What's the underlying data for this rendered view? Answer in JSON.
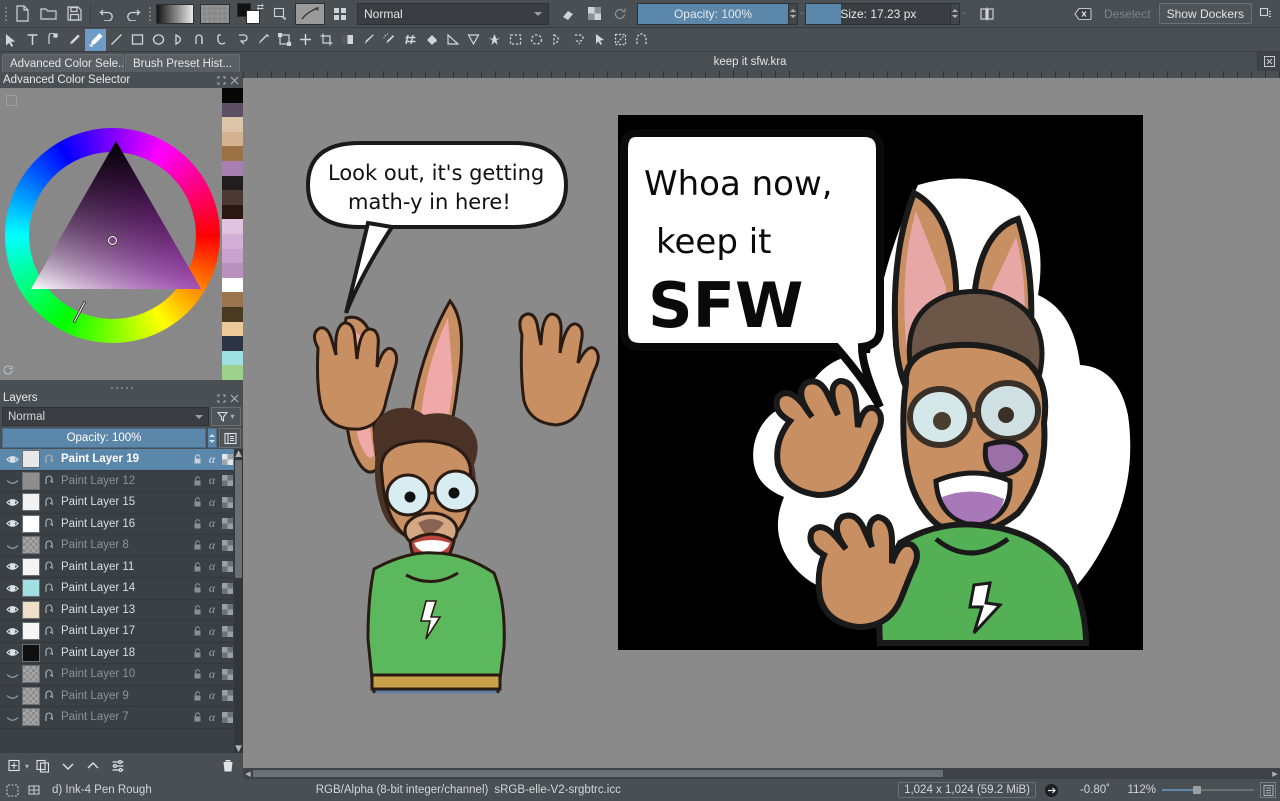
{
  "app": {
    "name": "Krita"
  },
  "toolbar": {
    "items": [
      {
        "name": "new-document-button",
        "icon": "new-file-icon",
        "label": "New"
      },
      {
        "name": "open-document-button",
        "icon": "folder-open-icon",
        "label": "Open"
      },
      {
        "name": "save-document-button",
        "icon": "floppy-save-icon",
        "label": "Save"
      },
      {
        "name": "undo-button",
        "icon": "undo-arrow-icon",
        "label": "Undo"
      },
      {
        "name": "redo-button",
        "icon": "redo-arrow-icon",
        "label": "Redo"
      }
    ],
    "gradient_label": "Gradients",
    "pattern_label": "Patterns",
    "fgbg_label": "Foreground/Background colors",
    "fill_layer_label": "Edit fill layer",
    "brush_editor_label": "Edit brush settings",
    "preset_chooser_label": "Choose brush preset",
    "blending_mode": "Normal",
    "eraser_label": "Eraser mode",
    "alpha_label": "Preserve alpha",
    "reset_label": "Reset",
    "opacity_label": "Opacity: 100%",
    "opacity_value": 100,
    "size_label": "Size: 17.23 px",
    "size_value": "17.23 px",
    "mirror_label": "Mirror",
    "deselect_label": "Deselect",
    "show_dockers_label": "Show Dockers"
  },
  "tools": {
    "active": "freehand-brush",
    "items": [
      {
        "name": "tool-select-shapes",
        "icon": "cursor-arrow-icon"
      },
      {
        "name": "tool-text",
        "icon": "text-icon"
      },
      {
        "name": "tool-edit-shapes",
        "icon": "node-edit-icon"
      },
      {
        "name": "tool-calligraphy",
        "icon": "calligraphy-pen-icon"
      },
      {
        "name": "tool-freehand-brush",
        "icon": "paintbrush-icon"
      },
      {
        "name": "tool-line",
        "icon": "line-icon"
      },
      {
        "name": "tool-rectangle",
        "icon": "rectangle-icon"
      },
      {
        "name": "tool-ellipse",
        "icon": "ellipse-icon"
      },
      {
        "name": "tool-polygon",
        "icon": "polygon-icon"
      },
      {
        "name": "tool-polyline",
        "icon": "polyline-icon"
      },
      {
        "name": "tool-bezier-curve",
        "icon": "bezier-curve-icon"
      },
      {
        "name": "tool-freehand-path",
        "icon": "freehand-path-icon"
      },
      {
        "name": "tool-dynamic-brush",
        "icon": "dynamic-brush-icon"
      },
      {
        "name": "tool-multibrush",
        "icon": "multibrush-icon"
      },
      {
        "name": "tool-transform",
        "icon": "transform-icon"
      },
      {
        "name": "tool-move",
        "icon": "move-cross-icon"
      },
      {
        "name": "tool-crop",
        "icon": "crop-icon"
      },
      {
        "name": "tool-gradient",
        "icon": "gradient-icon"
      },
      {
        "name": "tool-color-sampler",
        "icon": "eyedropper-icon"
      },
      {
        "name": "tool-colorize-mask",
        "icon": "colorize-mask-icon"
      },
      {
        "name": "tool-smart-patch",
        "icon": "smart-patch-icon"
      },
      {
        "name": "tool-fill",
        "icon": "fill-bucket-icon"
      },
      {
        "name": "tool-measure",
        "icon": "measure-icon"
      },
      {
        "name": "tool-assistant",
        "icon": "assistant-icon"
      },
      {
        "name": "tool-reference-images",
        "icon": "reference-image-icon"
      },
      {
        "name": "tool-rectangular-select",
        "icon": "rect-select-icon"
      },
      {
        "name": "tool-elliptical-select",
        "icon": "ellipse-select-icon"
      },
      {
        "name": "tool-polygonal-select",
        "icon": "polygon-select-icon"
      },
      {
        "name": "tool-freehand-select",
        "icon": "freehand-select-icon"
      },
      {
        "name": "tool-contiguous-select",
        "icon": "contiguous-select-icon"
      },
      {
        "name": "tool-similar-select",
        "icon": "similar-select-icon"
      },
      {
        "name": "tool-magnetic-select",
        "icon": "magnetic-select-icon"
      }
    ]
  },
  "left_dock": {
    "tabs": [
      {
        "name": "tab-advanced-color-selector",
        "label": "Advanced Color Sele...",
        "active": true
      },
      {
        "name": "tab-brush-preset-history",
        "label": "Brush Preset Hist...",
        "active": false
      }
    ],
    "color_selector": {
      "title": "Advanced Color Selector",
      "float_label": "Float docker",
      "close_label": "Close docker",
      "reset_label": "Reset",
      "palette_swatches": [
        "#070707",
        "#5c4f63",
        "#dcc5ab",
        "#d4b191",
        "#9a7245",
        "#a77fb0",
        "#211c1e",
        "#4a3a33",
        "#2a1713",
        "#dfc3e0",
        "#d3afd8",
        "#c9a3ce",
        "#b891bd",
        "#ffffff",
        "#9a7550",
        "#4a3a22",
        "#edc999",
        "#2b3344",
        "#9fe0e0",
        "#9dd18c"
      ]
    },
    "layers": {
      "title": "Layers",
      "float_label": "Float docker",
      "close_label": "Close docker",
      "blending_mode": "Normal",
      "filter_label": "Filter layers",
      "opacity_label": "Opacity:  100%",
      "opacity_value": 100,
      "properties_label": "Layer properties",
      "rows": [
        {
          "label": "Paint Layer 19",
          "visible": true,
          "selected": true,
          "thumb": "sketch"
        },
        {
          "label": "Paint Layer 12",
          "visible": false,
          "selected": false,
          "thumb": "gray-hatch"
        },
        {
          "label": "Paint Layer 15",
          "visible": true,
          "selected": false,
          "thumb": "white-spots"
        },
        {
          "label": "Paint Layer 16",
          "visible": true,
          "selected": false,
          "thumb": "white"
        },
        {
          "label": "Paint Layer 8",
          "visible": false,
          "selected": false,
          "thumb": "empty"
        },
        {
          "label": "Paint Layer 11",
          "visible": true,
          "selected": false,
          "thumb": "white-figure"
        },
        {
          "label": "Paint Layer 14",
          "visible": true,
          "selected": false,
          "thumb": "cyan-blocks"
        },
        {
          "label": "Paint Layer 13",
          "visible": true,
          "selected": false,
          "thumb": "color-figure"
        },
        {
          "label": "Paint Layer 17",
          "visible": true,
          "selected": false,
          "thumb": "light-checker"
        },
        {
          "label": "Paint Layer 18",
          "visible": true,
          "selected": false,
          "thumb": "black-blob"
        },
        {
          "label": "Paint Layer 10",
          "visible": false,
          "selected": false,
          "thumb": "empty"
        },
        {
          "label": "Paint Layer 9",
          "visible": false,
          "selected": false,
          "thumb": "empty"
        },
        {
          "label": "Paint Layer 7",
          "visible": false,
          "selected": false,
          "thumb": "empty"
        }
      ],
      "row_icons": {
        "visibility": "eye-icon",
        "inherit_alpha": "inherit-alpha-icon",
        "lock": "padlock-icon",
        "alpha": "alpha-icon",
        "alpha_lock": "alpha-lock-checker-icon"
      },
      "toolbar": [
        {
          "name": "add-layer-button",
          "icon": "add-layer-plus-icon"
        },
        {
          "name": "duplicate-layer-button",
          "icon": "duplicate-layer-icon"
        },
        {
          "name": "move-layer-down-button",
          "icon": "chevron-down-icon"
        },
        {
          "name": "move-layer-up-button",
          "icon": "chevron-up-icon"
        },
        {
          "name": "layer-properties-button",
          "icon": "sliders-icon"
        },
        {
          "name": "delete-layer-button",
          "icon": "trash-icon"
        }
      ]
    }
  },
  "document": {
    "tab_label": "keep it sfw.kra",
    "close_label": "Close document",
    "canvas_background": "#8a8a8a",
    "artwork": {
      "left_panel": {
        "speech_line1": "Look out, it's getting",
        "speech_line2": "math-y in here!",
        "shirt_color": "#5cb85c",
        "fur_color": "#c88f63",
        "jeans_color": "#5b7fa8"
      },
      "right_panel": {
        "background": "#000000",
        "speech_line1": "Whoa now,",
        "speech_line2": "keep it",
        "speech_line3": "SFW",
        "shirt_color": "#54b055",
        "fur_color": "#c88f63"
      }
    }
  },
  "statusbar": {
    "selection_mask_label": "Show selection mask",
    "assistant_label": "Show assistants",
    "brush_preset": "d) Ink-4 Pen Rough",
    "color_space": "RGB/Alpha (8-bit integer/channel)",
    "color_profile": "sRGB-elle-V2-srgbtrc.icc",
    "dimensions": "1,024 x 1,024 (59.2 MiB)",
    "rotation_icon": "canvas-rotation-icon",
    "rotation": "-0.80˚",
    "zoom": "112%",
    "zoom_value": 112,
    "fit_label": "Fit page"
  }
}
